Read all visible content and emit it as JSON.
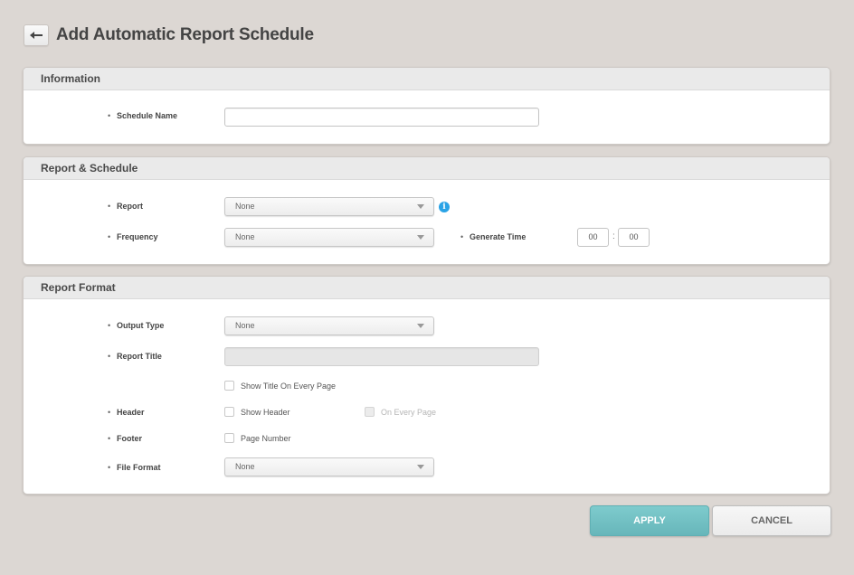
{
  "header": {
    "back_icon": "arrow-left-icon",
    "title": "Add Automatic Report Schedule"
  },
  "sections": {
    "information": {
      "title": "Information",
      "schedule_name": {
        "label": "Schedule Name",
        "value": "",
        "placeholder": ""
      }
    },
    "report_schedule": {
      "title": "Report & Schedule",
      "report": {
        "label": "Report",
        "selected": "None",
        "info_icon": "info-icon"
      },
      "frequency": {
        "label": "Frequency",
        "selected": "None"
      },
      "generate_time": {
        "label": "Generate Time",
        "hour": "00",
        "separator": ":",
        "minute": "00"
      }
    },
    "report_format": {
      "title": "Report Format",
      "output_type": {
        "label": "Output Type",
        "selected": "None"
      },
      "report_title": {
        "label": "Report Title",
        "value": "",
        "disabled": true
      },
      "show_title_every_page": {
        "label": "Show Title On Every Page",
        "checked": false
      },
      "header": {
        "label": "Header",
        "show_header": {
          "label": "Show Header",
          "checked": false
        },
        "on_every_page": {
          "label": "On Every Page",
          "checked": false,
          "disabled": true
        }
      },
      "footer": {
        "label": "Footer",
        "page_number": {
          "label": "Page Number",
          "checked": false
        }
      },
      "file_format": {
        "label": "File Format",
        "selected": "None"
      }
    }
  },
  "actions": {
    "apply_label": "APPLY",
    "cancel_label": "CANCEL"
  },
  "colors": {
    "background": "#dcd7d3",
    "apply_button": "#72c0c3",
    "info_icon": "#2aa3e6"
  }
}
